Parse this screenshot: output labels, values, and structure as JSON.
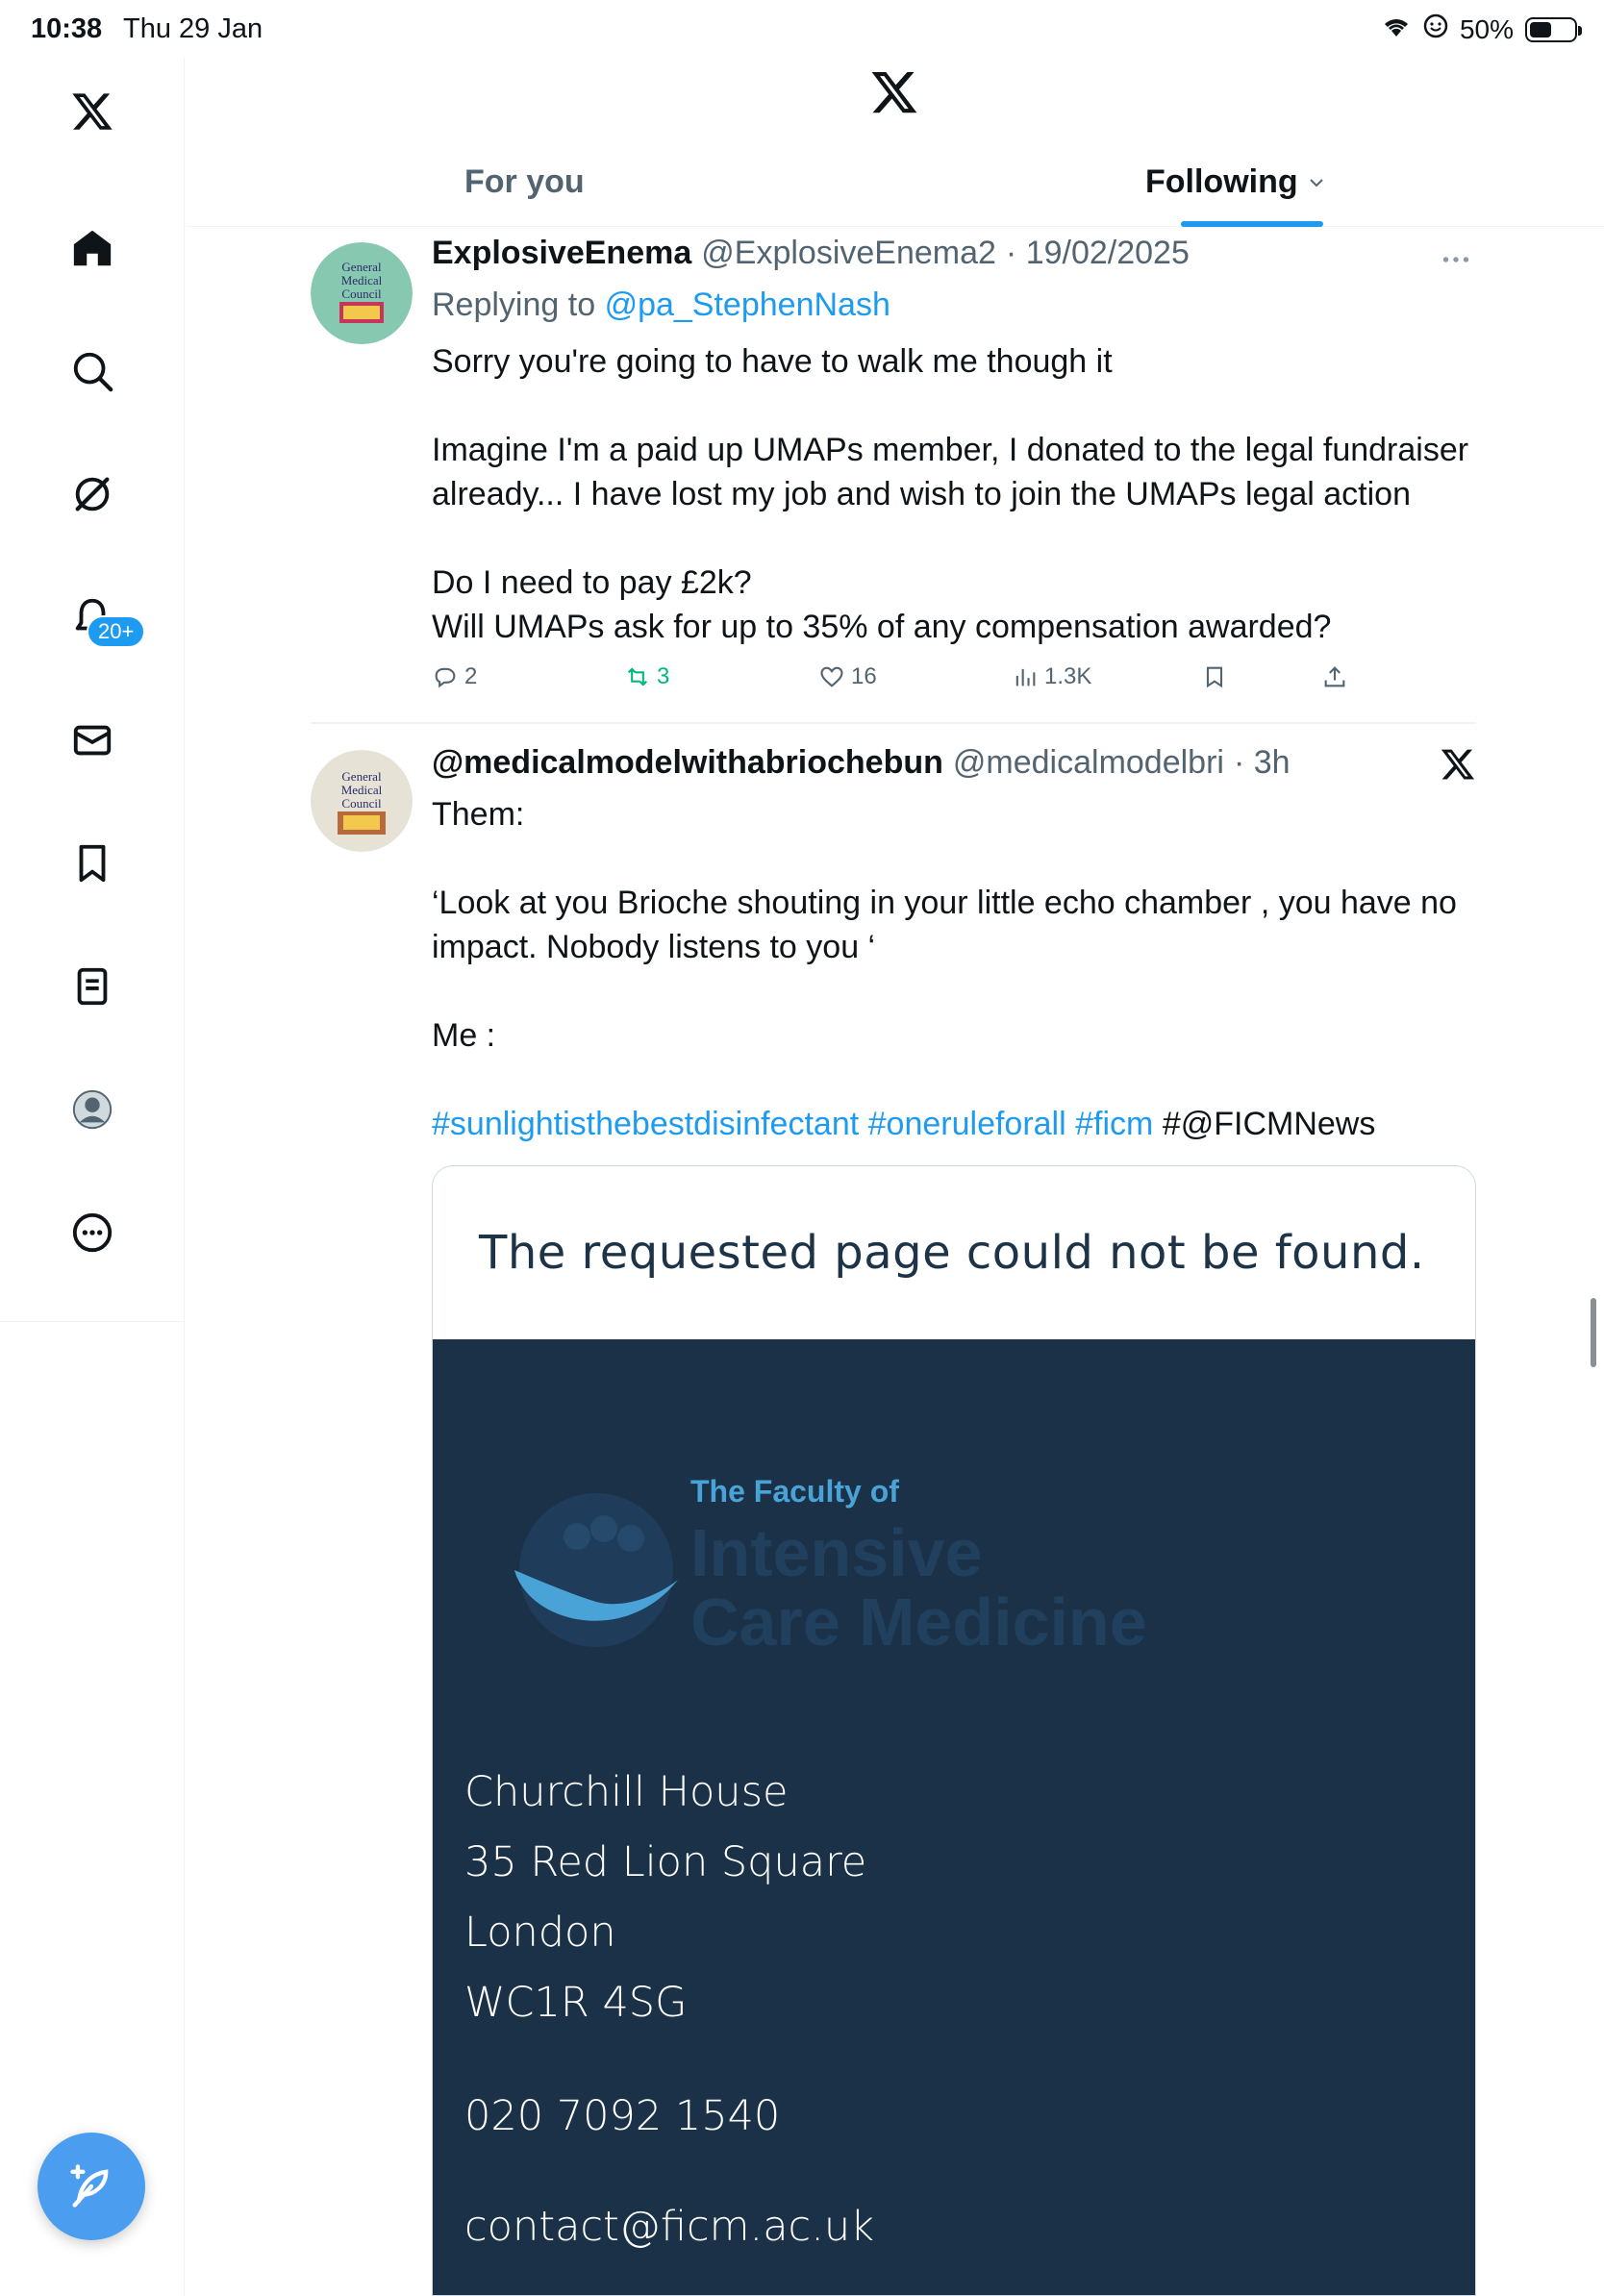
{
  "status_bar": {
    "time": "10:38",
    "date": "Thu 29 Jan",
    "battery": "50%",
    "battery_level": 0.5
  },
  "sidebar": {
    "items": [
      {
        "name": "logo",
        "icon": "x-logo-icon"
      },
      {
        "name": "home",
        "icon": "home-icon"
      },
      {
        "name": "explore",
        "icon": "search-icon"
      },
      {
        "name": "grok",
        "icon": "grok-icon"
      },
      {
        "name": "notifications",
        "icon": "bell-icon",
        "badge": "20+"
      },
      {
        "name": "messages",
        "icon": "mail-icon"
      },
      {
        "name": "bookmarks",
        "icon": "bookmark-icon"
      },
      {
        "name": "lists",
        "icon": "list-icon"
      },
      {
        "name": "profile",
        "icon": "profile-icon"
      },
      {
        "name": "more",
        "icon": "more-circle-icon"
      }
    ],
    "compose_icon": "compose-icon"
  },
  "header": {
    "tabs": [
      "For you",
      "Following"
    ],
    "active_tab": "Following"
  },
  "tweets": [
    {
      "name": "ExplosiveEnema",
      "handle": "@ExplosiveEnema2",
      "date": "· 19/02/2025",
      "replying_prefix": "Replying to",
      "replying_to": "@pa_StephenNash",
      "lines": [
        "Sorry you're going to have to walk me though it",
        "Imagine I'm a paid up UMAPs member, I donated to the legal fundraiser",
        "already... I have lost my job and wish to join the UMAPs legal action",
        "Do I need to pay £2k?",
        "Will UMAPs ask for up to 35% of any compensation awarded?"
      ],
      "stats": {
        "replies": "2",
        "retweets": "3",
        "likes": "16",
        "views": "1.3K"
      }
    },
    {
      "name": "@medicalmodelwithabriochebun",
      "handle": "@medicalmodelbri",
      "date": "· 3h",
      "lines": [
        "Them:",
        "‘Look at you Brioche shouting in your little echo chamber , you have no",
        "impact. Nobody listens to you ‘",
        "Me :"
      ],
      "hashtags": [
        "#sunlightisthebestdisinfectant",
        "#oneruleforall",
        "#ficm"
      ],
      "mention_tail": "#@FICMNews",
      "card": {
        "headline": "The requested page could not be found.",
        "logo_small": "The Faculty of",
        "logo_line1": "Intensive",
        "logo_line2": "Care Medicine",
        "address": [
          "Churchill House",
          "35 Red Lion Square",
          "London",
          "WC1R 4SG"
        ],
        "phone": "020 7092 1540",
        "email": "contact@ficm.ac.uk"
      }
    }
  ],
  "colors": {
    "accent": "#1d9bf0",
    "card_bg": "#1b3148",
    "retweeted": "#00ba7c"
  }
}
